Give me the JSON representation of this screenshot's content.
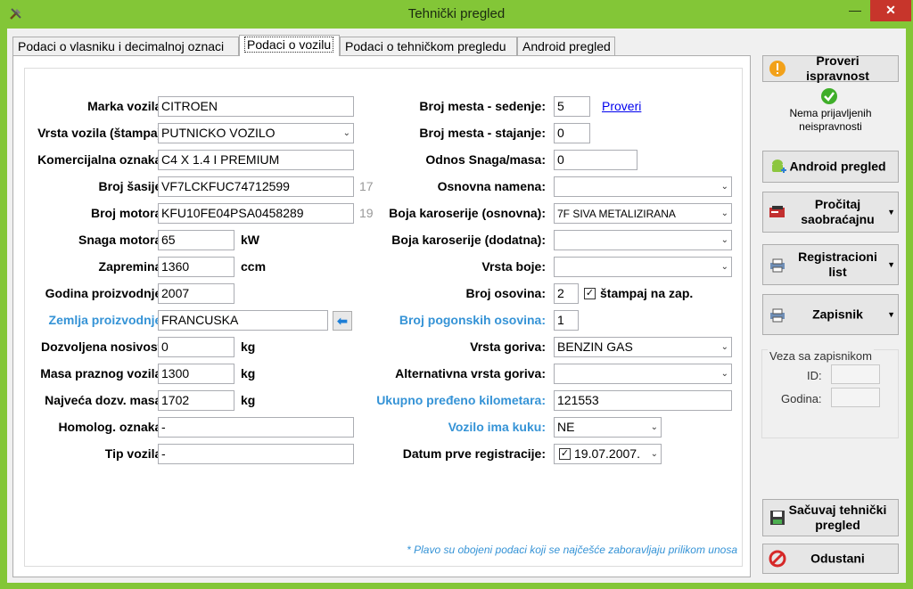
{
  "window": {
    "title": "Tehnički pregled",
    "minimize": "—",
    "close": "✕"
  },
  "tabs": [
    {
      "label": "Podaci o vlasniku i decimalnoj oznaci"
    },
    {
      "label": "Podaci o vozilu"
    },
    {
      "label": "Podaci o tehničkom pregledu"
    },
    {
      "label": "Android pregled"
    }
  ],
  "left_fields": {
    "marka": {
      "label": "Marka vozila:",
      "value": "CITROEN"
    },
    "vrsta": {
      "label": "Vrsta vozila (štampa):",
      "value": "PUTNICKO VOZILO"
    },
    "komercijalna": {
      "label": "Komercijalna oznaka:",
      "value": "C4 X 1.4 I PREMIUM"
    },
    "sasija": {
      "label": "Broj šasije:",
      "value": "VF7LCKFUC74712599",
      "count": "17"
    },
    "motor": {
      "label": "Broj motora:",
      "value": "KFU10FE04PSA0458289",
      "count": "19"
    },
    "snaga": {
      "label": "Snaga motora:",
      "value": "65",
      "unit": "kW"
    },
    "zapremina": {
      "label": "Zapremina:",
      "value": "1360",
      "unit": "ccm"
    },
    "godina": {
      "label": "Godina proizvodnje:",
      "value": "2007"
    },
    "zemlja": {
      "label": "Zemlja proizvodnje:",
      "value": "FRANCUSKA"
    },
    "nosivost": {
      "label": "Dozvoljena nosivost:",
      "value": "0",
      "unit": "kg"
    },
    "masa_praznog": {
      "label": "Masa praznog vozila:",
      "value": "1300",
      "unit": "kg"
    },
    "najveca_masa": {
      "label": "Najveća dozv. masa:",
      "value": "1702",
      "unit": "kg"
    },
    "homolog": {
      "label": "Homolog. oznaka:",
      "value": "-"
    },
    "tip": {
      "label": "Tip vozila:",
      "value": "-"
    }
  },
  "right_fields": {
    "mesta_sedenje": {
      "label": "Broj mesta - sedenje:",
      "value": "5",
      "link": "Proveri"
    },
    "mesta_stajanje": {
      "label": "Broj mesta - stajanje:",
      "value": "0"
    },
    "odnos": {
      "label": "Odnos Snaga/masa:",
      "value": "0"
    },
    "namena": {
      "label": "Osnovna namena:",
      "value": ""
    },
    "boja_osnovna": {
      "label": "Boja karoserije (osnovna):",
      "value": "7F SIVA METALIZIRANA"
    },
    "boja_dodatna": {
      "label": "Boja karoserije (dodatna):",
      "value": ""
    },
    "vrsta_boje": {
      "label": "Vrsta boje:",
      "value": ""
    },
    "osovine": {
      "label": "Broj osovina:",
      "value": "2",
      "checkbox_label": "štampaj na zap.",
      "checked": true
    },
    "pogonske": {
      "label": "Broj pogonskih osovina:",
      "value": "1"
    },
    "gorivo": {
      "label": "Vrsta goriva:",
      "value": "BENZIN GAS"
    },
    "alt_gorivo": {
      "label": "Alternativna vrsta goriva:",
      "value": ""
    },
    "kilometri": {
      "label": "Ukupno pređeno kilometara:",
      "value": "121553"
    },
    "kuka": {
      "label": "Vozilo ima kuku:",
      "value": "NE"
    },
    "datum": {
      "label": "Datum prve registracije:",
      "value": "19.07.2007.",
      "checked": true
    }
  },
  "note": "* Plavo su obojeni podaci koji se najčešće zaboravljaju prilikom unosa",
  "side": {
    "proveri": "Proveri ispravnost",
    "status": "Nema prijavljenih neispravnosti",
    "android": "Android pregled",
    "procitaj": "Pročitaj saobraćajnu",
    "registracioni": "Registracioni list",
    "zapisnik": "Zapisnik",
    "veza_caption": "Veza sa zapisnikom",
    "id_label": "ID:",
    "godina_label": "Godina:",
    "sacuvaj": "Sačuvaj tehnički pregled",
    "odustani": "Odustani"
  },
  "colors": {
    "titlebar": "#83c637",
    "accent_blue": "#3593d6",
    "close": "#c7352b"
  }
}
